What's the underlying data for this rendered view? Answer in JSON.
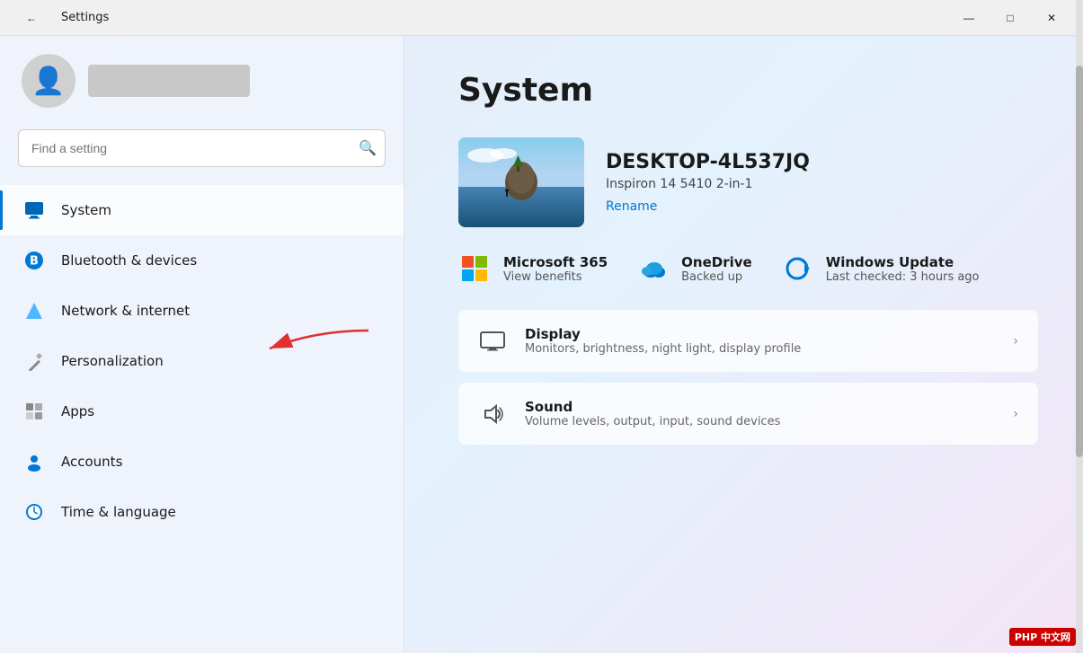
{
  "titlebar": {
    "title": "Settings",
    "back_label": "←",
    "minimize_label": "—",
    "maximize_label": "□",
    "close_label": "✕"
  },
  "sidebar": {
    "search_placeholder": "Find a setting",
    "search_icon": "🔍",
    "nav_items": [
      {
        "id": "system",
        "label": "System",
        "icon": "💻",
        "active": true,
        "color": "#0067b8"
      },
      {
        "id": "bluetooth",
        "label": "Bluetooth & devices",
        "icon": "🔵",
        "active": false,
        "color": "#0078d4"
      },
      {
        "id": "network",
        "label": "Network & internet",
        "icon": "💎",
        "active": false,
        "color": "#4db8ff"
      },
      {
        "id": "personalization",
        "label": "Personalization",
        "icon": "✏️",
        "active": false,
        "color": "#888"
      },
      {
        "id": "apps",
        "label": "Apps",
        "icon": "🔲",
        "active": false,
        "color": "#888"
      },
      {
        "id": "accounts",
        "label": "Accounts",
        "icon": "👤",
        "active": false,
        "color": "#0078d4"
      },
      {
        "id": "time",
        "label": "Time & language",
        "icon": "🌐",
        "active": false,
        "color": "#0078d4"
      }
    ]
  },
  "main": {
    "page_title": "System",
    "device_name": "DESKTOP-4L537JQ",
    "device_model": "Inspiron 14 5410 2-in-1",
    "device_rename": "Rename",
    "ms365_title": "Microsoft 365",
    "ms365_sub": "View benefits",
    "onedrive_title": "OneDrive",
    "onedrive_sub": "Backed up",
    "windows_update_title": "Windows Update",
    "windows_update_sub": "Last checked: 3 hours ago",
    "settings_items": [
      {
        "id": "display",
        "title": "Display",
        "desc": "Monitors, brightness, night light, display profile",
        "icon": "display"
      },
      {
        "id": "sound",
        "title": "Sound",
        "desc": "Volume levels, output, input, sound devices",
        "icon": "sound"
      }
    ]
  }
}
